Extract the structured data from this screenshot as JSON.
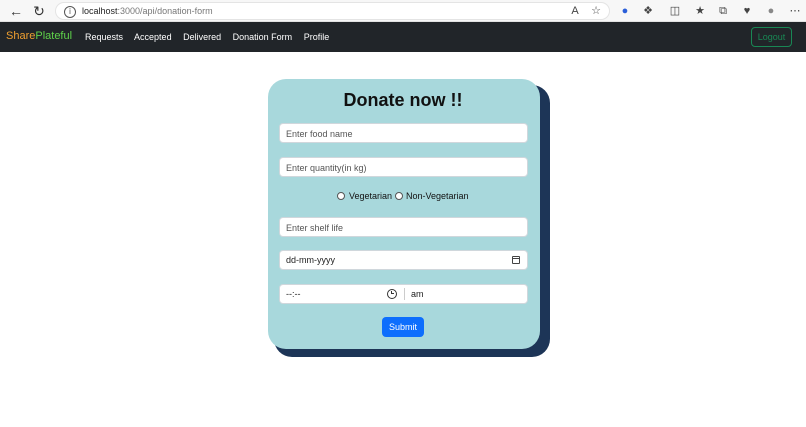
{
  "browser": {
    "url_host": "localhost",
    "url_rest": ":3000/api/donation-form"
  },
  "navbar": {
    "brand_part1": "Share",
    "brand_part2": "Plateful",
    "links": [
      "Requests",
      "Accepted",
      "Delivered",
      "Donation Form",
      "Profile"
    ],
    "logout_label": "Logout"
  },
  "form": {
    "title": "Donate now !!",
    "food_name_placeholder": "Enter food name",
    "quantity_placeholder": "Enter quantity(in kg)",
    "radio_veg_label": "Vegetarian",
    "radio_nonveg_label": "Non-Vegetarian",
    "shelf_life_placeholder": "Enter shelf life",
    "date_value": "dd-mm-yyyy",
    "time_value": "--:--",
    "ampm_value": "am",
    "submit_label": "Submit"
  },
  "colors": {
    "navbar_bg": "#212529",
    "brand_share": "#f0a030",
    "brand_plateful": "#5fd34a",
    "card_bg": "#a8d8dc",
    "card_shadow": "#1d3557",
    "submit_bg": "#0d6efd",
    "logout_border": "#198754"
  }
}
